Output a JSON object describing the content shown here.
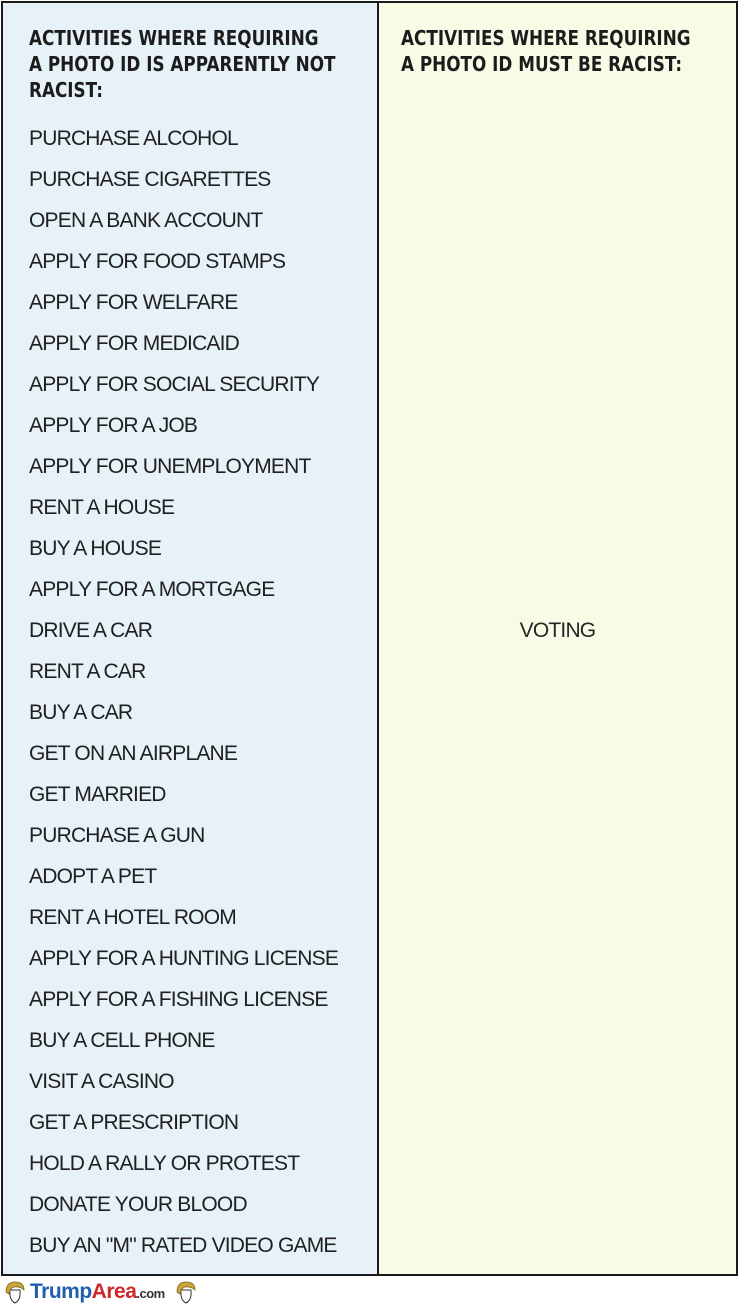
{
  "left_column": {
    "heading": "ACTIVITIES WHERE REQUIRING\nA PHOTO ID IS APPARENTLY NOT\nRACIST:",
    "items": [
      "PURCHASE ALCOHOL",
      "PURCHASE CIGARETTES",
      "OPEN A BANK ACCOUNT",
      "APPLY FOR FOOD STAMPS",
      "APPLY FOR WELFARE",
      "APPLY FOR MEDICAID",
      "APPLY FOR SOCIAL SECURITY",
      "APPLY FOR A JOB",
      "APPLY FOR UNEMPLOYMENT",
      "RENT A HOUSE",
      "BUY A HOUSE",
      "APPLY FOR A MORTGAGE",
      "DRIVE A CAR",
      "RENT A CAR",
      "BUY A CAR",
      "GET ON AN AIRPLANE",
      "GET MARRIED",
      "PURCHASE A GUN",
      "ADOPT A PET",
      "RENT A HOTEL ROOM",
      "APPLY FOR A HUNTING LICENSE",
      "APPLY FOR A FISHING LICENSE",
      "BUY A CELL PHONE",
      "VISIT A CASINO",
      "GET A PRESCRIPTION",
      "HOLD A RALLY OR PROTEST",
      "DONATE YOUR BLOOD",
      "BUY AN \"M\" RATED VIDEO GAME"
    ]
  },
  "right_column": {
    "heading": "ACTIVITIES WHERE REQUIRING\nA PHOTO ID MUST BE RACIST:",
    "item": "VOTING"
  },
  "footer": {
    "logo_part1": "Trump",
    "logo_part2": "Area",
    "logo_part3": ".com",
    "icon": "trump-head-icon"
  },
  "colors": {
    "left_bg": "#e6f1f8",
    "right_bg": "#f9fbe6",
    "logo_blue": "#1f5fae",
    "logo_red": "#cc2a2a"
  }
}
